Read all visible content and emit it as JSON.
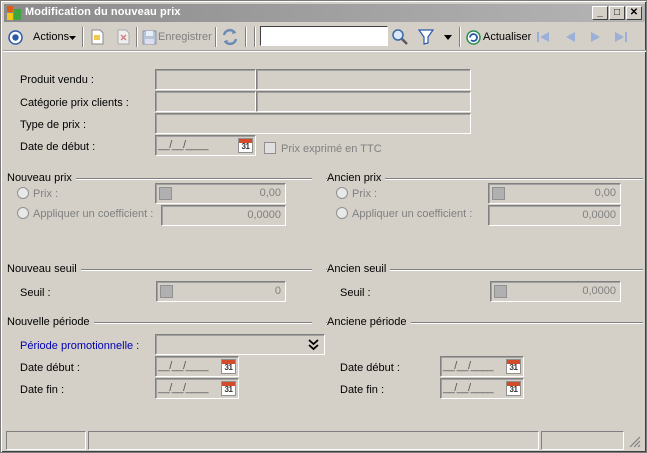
{
  "window": {
    "title": "Modification du nouveau prix",
    "minimize": "_",
    "maximize": "□",
    "close": "✕"
  },
  "toolbar": {
    "actions_label": "Actions",
    "save_label": "Enregistrer",
    "search_value": "",
    "refresh_label": "Actualiser"
  },
  "form": {
    "produit_label": "Produit vendu :",
    "categorie_label": "Catégorie prix clients :",
    "type_label": "Type de prix :",
    "date_debut_label": "Date de début :",
    "date_debut_value": "__/__/____",
    "ttc_label": "Prix exprimé en TTC"
  },
  "nouveau_prix": {
    "title": "Nouveau prix",
    "prix_label": "Prix :",
    "prix_value": "0,00",
    "coef_label": "Appliquer un coefficient :",
    "coef_value": "0,0000"
  },
  "ancien_prix": {
    "title": "Ancien prix",
    "prix_label": "Prix :",
    "prix_value": "0,00",
    "coef_label": "Appliquer un coefficient :",
    "coef_value": "0,0000"
  },
  "nouveau_seuil": {
    "title": "Nouveau seuil",
    "seuil_label": "Seuil :",
    "seuil_value": "0"
  },
  "ancien_seuil": {
    "title": "Ancien seuil",
    "seuil_label": "Seuil :",
    "seuil_value": "0,0000"
  },
  "nouvelle_periode": {
    "title": "Nouvelle période",
    "promo_label": "Période promotionnelle :",
    "debut_label": "Date début :",
    "debut_value": "__/__/____",
    "fin_label": "Date fin :",
    "fin_value": "__/__/____"
  },
  "ancienne_periode": {
    "title": "Anciene période",
    "debut_label": "Date début :",
    "debut_value": "__/__/____",
    "fin_label": "Date fin :",
    "fin_value": "__/__/____"
  },
  "calendar_day": "31",
  "colors": {
    "background": "#d4d0c8",
    "link_label": "#0000b0",
    "disabled_text": "#808080",
    "title_gradient_start": "#8a8a8a",
    "title_gradient_end": "#b5b5b5"
  },
  "icons": [
    "app-icon",
    "actions-circle-icon",
    "dropdown-arrow-icon",
    "new-doc-icon",
    "delete-icon",
    "save-icon",
    "refresh-icon",
    "search-icon",
    "filter-icon",
    "refresh-circle-icon",
    "first-icon",
    "prev-icon",
    "next-icon",
    "last-icon",
    "calendar-icon",
    "double-chevron-down-icon",
    "resize-grip-icon"
  ]
}
